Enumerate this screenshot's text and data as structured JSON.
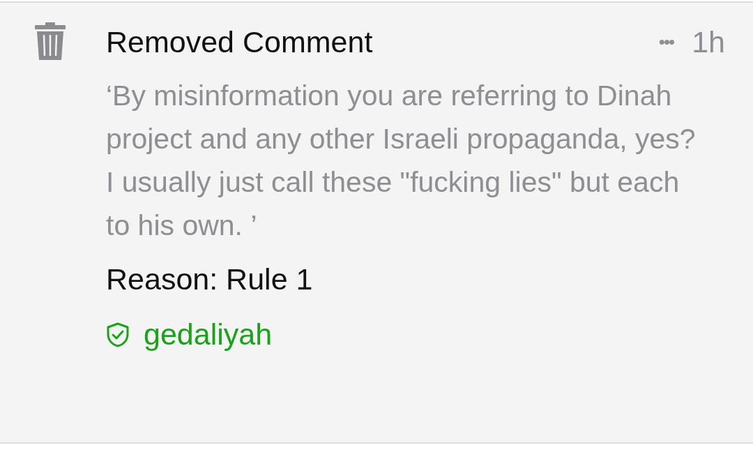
{
  "comment": {
    "title": "Removed Comment",
    "menu": "•••",
    "time": "1h",
    "body": "‘By misinformation you are referring to Dinah project and any other Israeli propaganda, yes? I usually just call these \"fucking lies\" but each to his own. ’",
    "reason": "Reason: Rule 1",
    "moderator": "gedaliyah"
  }
}
